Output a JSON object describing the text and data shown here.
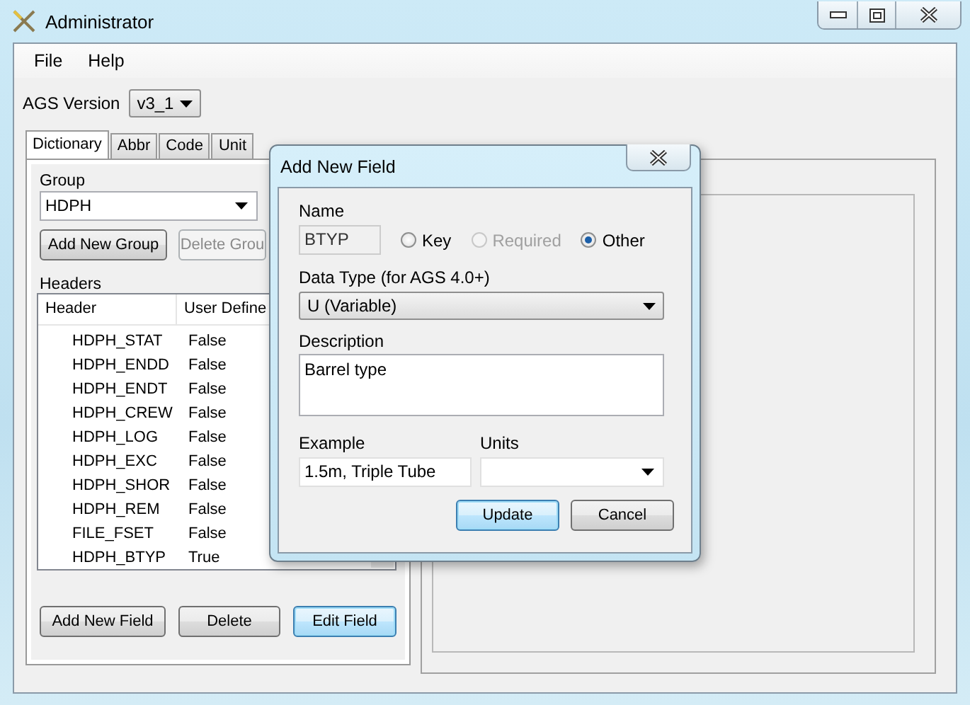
{
  "window": {
    "title": "Administrator"
  },
  "menu": [
    {
      "label": "File"
    },
    {
      "label": "Help"
    }
  ],
  "version": {
    "label": "AGS Version",
    "value": "v3_1"
  },
  "tabs": [
    {
      "label": "Dictionary",
      "selected": true
    },
    {
      "label": "Abbr",
      "selected": false
    },
    {
      "label": "Code",
      "selected": false
    },
    {
      "label": "Unit",
      "selected": false
    }
  ],
  "group": {
    "label": "Group",
    "value": "HDPH"
  },
  "group_buttons": [
    {
      "label": "Add New Group",
      "disabled": false
    },
    {
      "label": "Delete Grou",
      "disabled": true
    }
  ],
  "headers": {
    "label": "Headers",
    "columns": [
      "Header",
      "User Define"
    ],
    "rows": [
      {
        "header": "HDPH_STAT",
        "user_defined": "False"
      },
      {
        "header": "HDPH_ENDD",
        "user_defined": "False"
      },
      {
        "header": "HDPH_ENDT",
        "user_defined": "False"
      },
      {
        "header": "HDPH_CREW",
        "user_defined": "False"
      },
      {
        "header": "HDPH_LOG",
        "user_defined": "False"
      },
      {
        "header": "HDPH_EXC",
        "user_defined": "False"
      },
      {
        "header": "HDPH_SHOR",
        "user_defined": "False"
      },
      {
        "header": "HDPH_REM",
        "user_defined": "False"
      },
      {
        "header": "FILE_FSET",
        "user_defined": "False"
      },
      {
        "header": "HDPH_BTYP",
        "user_defined": "True"
      }
    ]
  },
  "field_buttons": [
    {
      "label": "Add New Field",
      "focused": false
    },
    {
      "label": "Delete",
      "focused": false
    },
    {
      "label": "Edit Field",
      "focused": true
    }
  ],
  "dialog": {
    "title": "Add New Field",
    "name_label": "Name",
    "name_value": "BTYP",
    "radios": [
      {
        "label": "Key",
        "selected": false,
        "disabled": false
      },
      {
        "label": "Required",
        "selected": false,
        "disabled": true
      },
      {
        "label": "Other",
        "selected": true,
        "disabled": false
      }
    ],
    "data_type_label": "Data Type (for AGS 4.0+)",
    "data_type_value": "U (Variable)",
    "description_label": "Description",
    "description_value": "Barrel type",
    "example_label": "Example",
    "example_value": "1.5m, Triple Tube",
    "units_label": "Units",
    "buttons": [
      {
        "label": "Update",
        "focused": true
      },
      {
        "label": "Cancel",
        "focused": false
      }
    ]
  }
}
